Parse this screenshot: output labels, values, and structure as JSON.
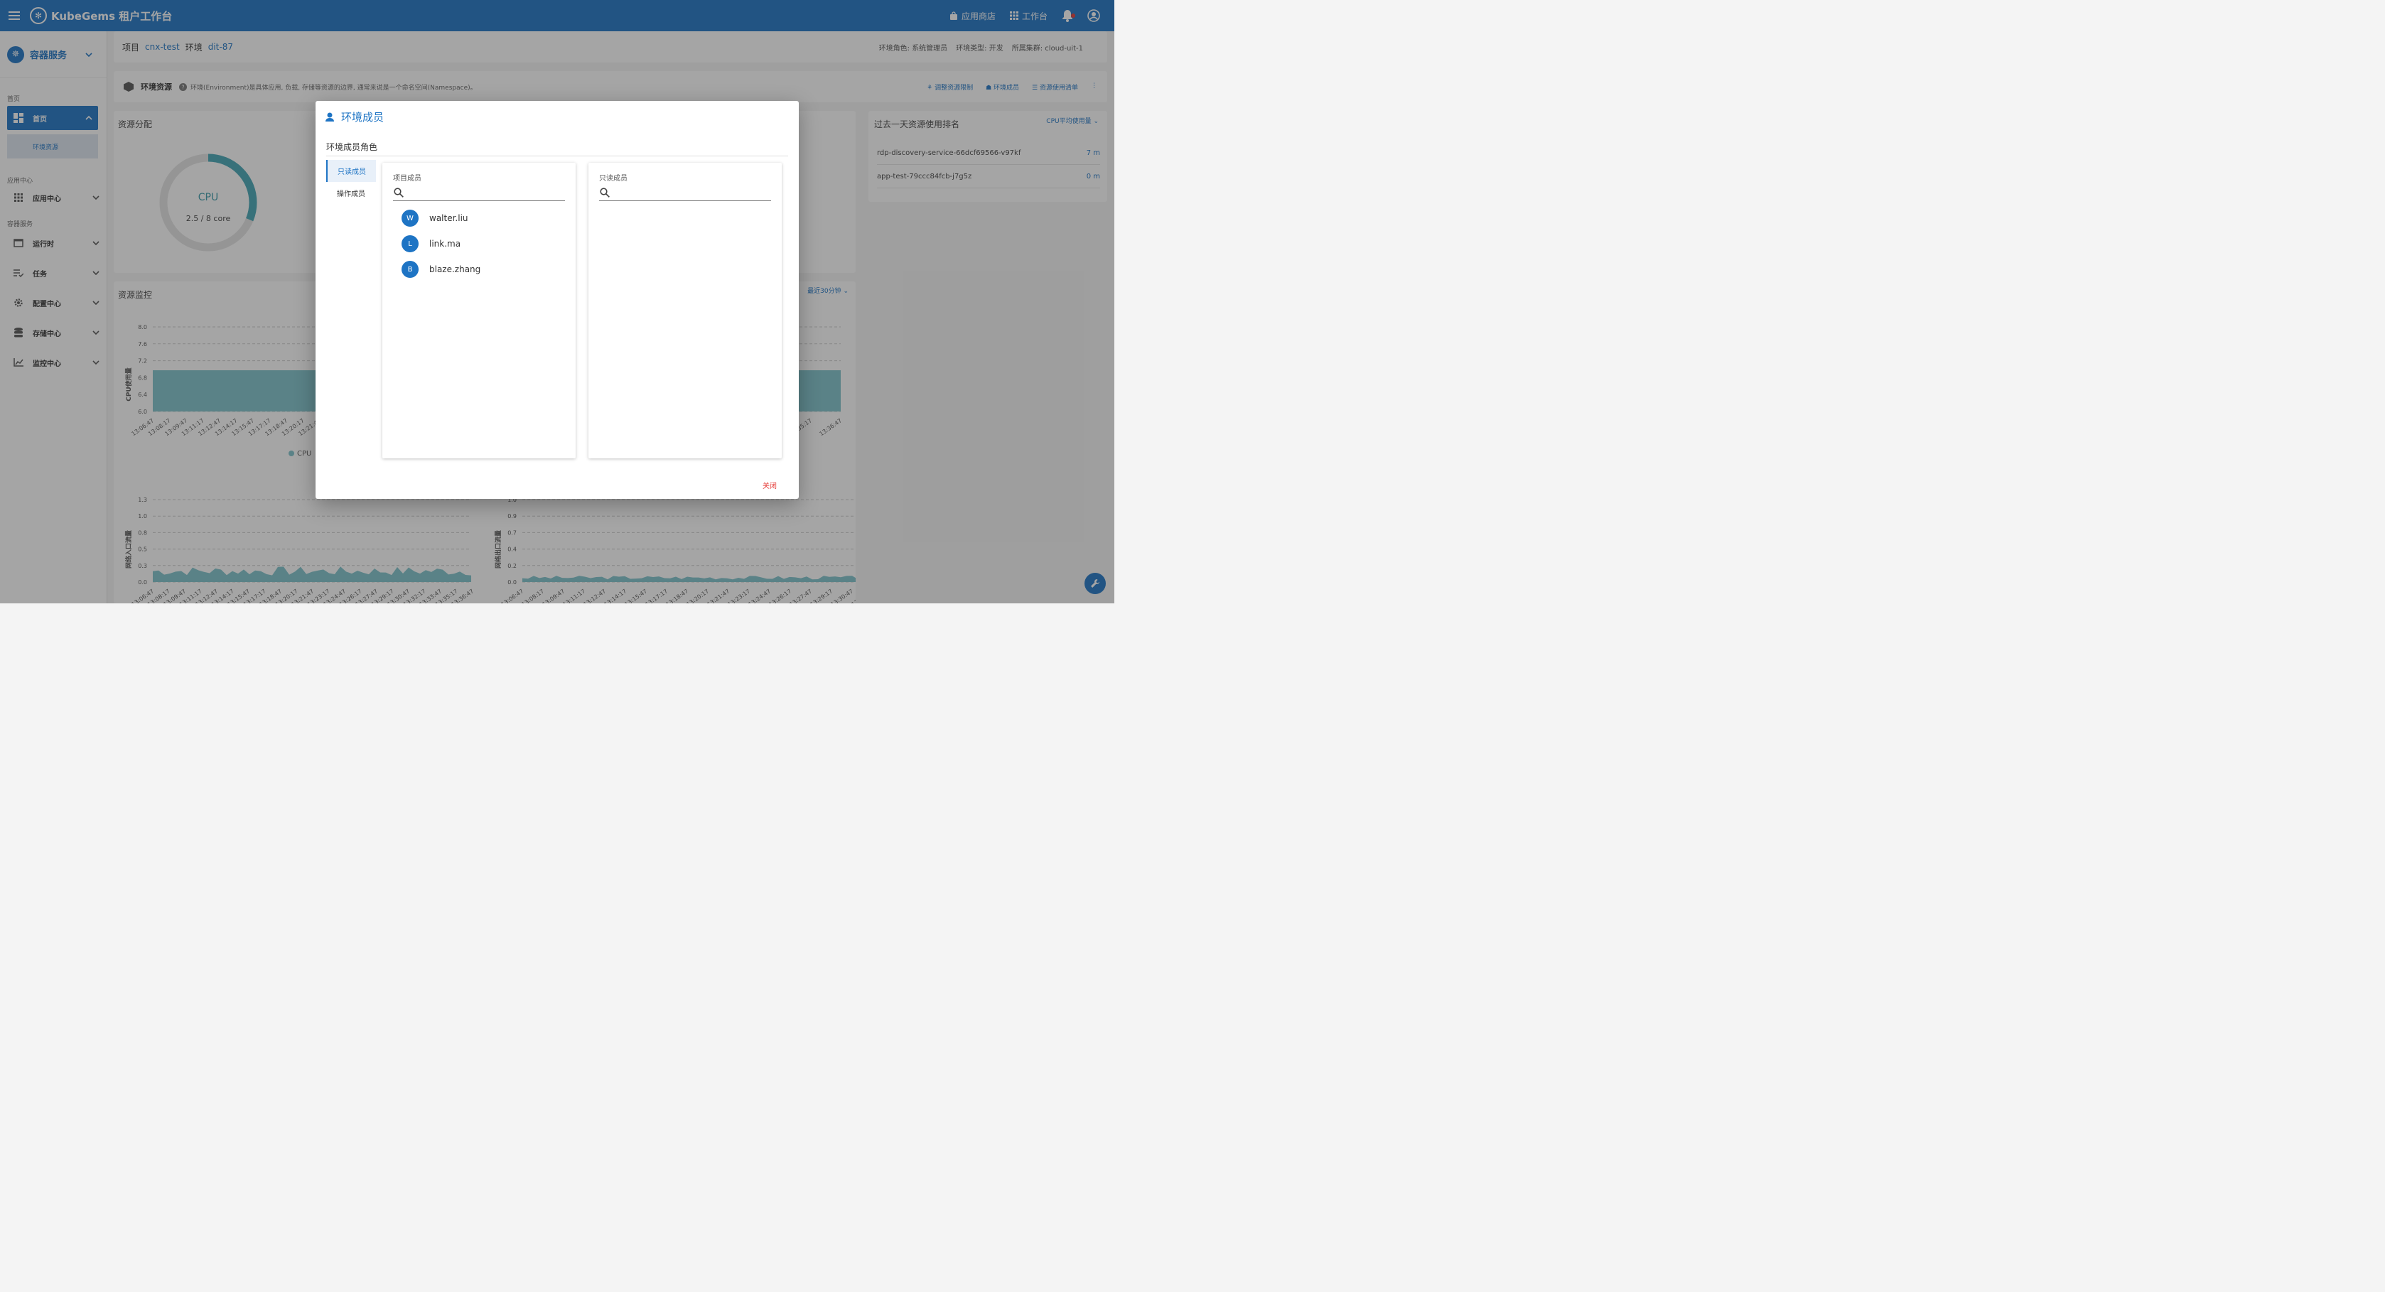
{
  "topbar": {
    "brand": "KubeGems 租户工作台",
    "app_store": "应用商店",
    "workbench": "工作台"
  },
  "sidebar": {
    "header": "容器服务",
    "sections": {
      "home": "首页",
      "app_center": "应用中心",
      "container": "容器服务"
    },
    "items": {
      "home": "首页",
      "env_resources": "环境资源",
      "app_center": "应用中心",
      "runtime": "运行时",
      "tasks": "任务",
      "config_center": "配置中心",
      "storage_center": "存储中心",
      "monitor_center": "监控中心"
    }
  },
  "breadcrumb": {
    "project_label": "项目",
    "project": "cnx-test",
    "env_label": "环境",
    "env": "dit-87",
    "role": "环境角色: 系统管理员",
    "env_type": "环境类型: 开发",
    "cluster": "所属集群: cloud-uit-1"
  },
  "resource_bar": {
    "title": "环境资源",
    "desc": "环境(Environment)是具体应用, 负载, 存储等资源的边界, 通常来说是一个命名空间(Namespace)。",
    "adjust_limit": "调整资源限制",
    "members": "环境成员",
    "usage_list": "资源使用清单"
  },
  "distribution": {
    "title": "资源分配",
    "cpu_label": "CPU",
    "cpu_value": "2.5 / 8 core",
    "cpu_fraction": 0.3125
  },
  "ranking": {
    "title": "过去一天资源使用排名",
    "metric": "CPU平均使用量",
    "rows": [
      {
        "name": "rdp-discovery-service-66dcf69566-v97kf",
        "value": "7 m"
      },
      {
        "name": "app-test-79ccc84fcb-j7g5z",
        "value": "0 m"
      }
    ]
  },
  "monitor": {
    "title": "资源监控",
    "range": "最近30分钟",
    "cpu_chart": {
      "ylabel": "CPU使用量",
      "legend": "CPU",
      "yticks": [
        "8.0",
        "7.6",
        "7.2",
        "6.8",
        "6.4",
        "6.0"
      ],
      "xticks": [
        "13:06:47",
        "13:08:17",
        "13:09:47",
        "13:11:17",
        "13:12:47",
        "13:14:17",
        "13:15:47",
        "13:17:17",
        "13:18:47",
        "13:20:17",
        "13:21:47"
      ],
      "xticks_right": [
        "13:35:17",
        "13:36:47"
      ]
    },
    "net_in_chart": {
      "ylabel": "网络入口流量",
      "yticks": [
        "1.3",
        "1.0",
        "0.8",
        "0.5",
        "0.3",
        "0.0"
      ],
      "xticks": [
        "13:06:47",
        "13:08:17",
        "13:09:47",
        "13:11:17",
        "13:12:47",
        "13:14:17",
        "13:15:47",
        "13:17:17",
        "13:18:47",
        "13:20:17",
        "13:21:47",
        "13:23:17",
        "13:24:47",
        "13:26:17",
        "13:27:47",
        "13:29:17",
        "13:30:47",
        "13:32:17",
        "13:33:47",
        "13:35:17",
        "13:36:47"
      ]
    },
    "net_out_chart": {
      "ylabel": "网络出口流量",
      "yticks": [
        "1.0",
        "0.9",
        "0.7",
        "0.4",
        "0.2",
        "0.0"
      ],
      "xticks": [
        "13:06:47",
        "13:08:17",
        "13:09:47",
        "13:11:17",
        "13:12:47",
        "13:14:17",
        "13:15:47",
        "13:17:17",
        "13:18:47",
        "13:20:17",
        "13:21:47",
        "13:23:17",
        "13:24:47",
        "13:26:17",
        "13:27:47",
        "13:29:17",
        "13:30:47",
        "13:32:17",
        "13:33:47",
        "13:35:17",
        "13:36:47"
      ]
    }
  },
  "dialog": {
    "title": "环境成员",
    "subtitle": "环境成员角色",
    "tabs": [
      "只读成员",
      "操作成员"
    ],
    "left_label": "项目成员",
    "right_label": "只读成员",
    "members": [
      {
        "initial": "W",
        "name": "walter.liu"
      },
      {
        "initial": "L",
        "name": "link.ma"
      },
      {
        "initial": "B",
        "name": "blaze.zhang"
      }
    ],
    "close": "关闭"
  },
  "colors": {
    "primary": "#1e74c4",
    "chart": "#7ec3cb",
    "danger": "#e53935"
  }
}
